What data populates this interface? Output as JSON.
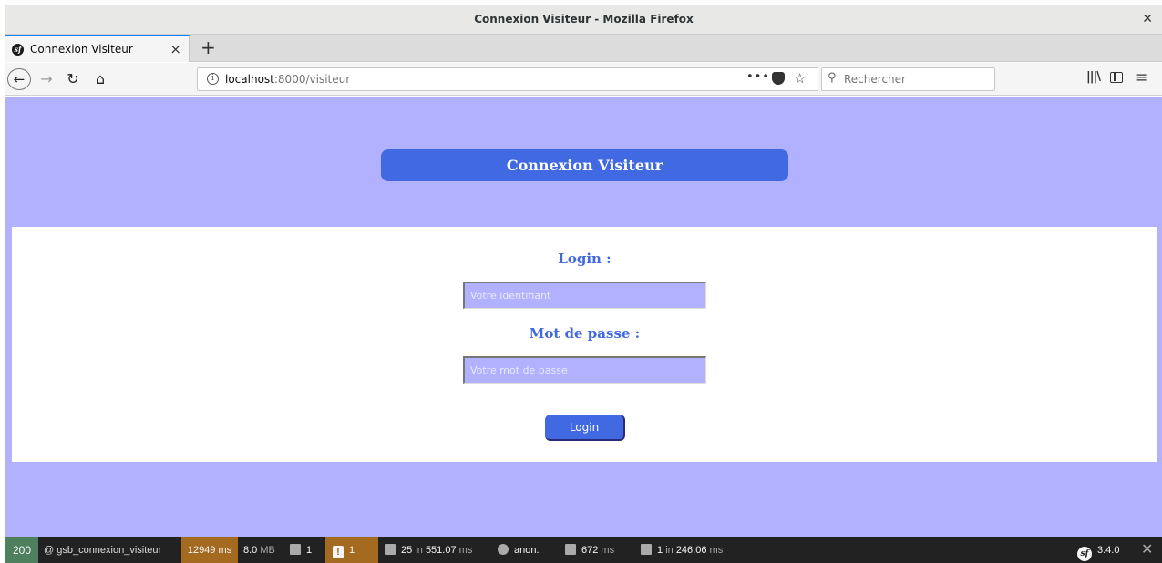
{
  "window": {
    "title": "Connexion Visiteur - Mozilla Firefox"
  },
  "tab": {
    "label": "Connexion Visiteur"
  },
  "navbar": {
    "url_host": "localhost",
    "url_path": ":8000/visiteur",
    "search_placeholder": "Rechercher"
  },
  "page": {
    "header": "Connexion Visiteur",
    "login_label": "Login :",
    "login_placeholder": "Votre identifiant",
    "password_label": "Mot de passe :",
    "password_placeholder": "Votre mot de passe",
    "submit_label": "Login"
  },
  "symfony_toolbar": {
    "status": "200",
    "route": "@ gsb_connexion_visiteur",
    "time_value": "12949",
    "time_unit": "ms",
    "memory_value": "8.0",
    "memory_unit": "MB",
    "forms_count": "1",
    "logs_count": "1",
    "doctrine_queries": "25",
    "doctrine_in": "in",
    "doctrine_time": "551.07",
    "doctrine_unit": "ms",
    "user": "anon.",
    "render_time": "672",
    "render_unit": "ms",
    "cache_count": "1",
    "cache_in": "in",
    "cache_time": "246.06",
    "cache_unit": "ms",
    "version": "3.4.0"
  },
  "colors": {
    "page_background": "#b1b1ff",
    "accent": "#4169e1",
    "status_ok": "#4f805d",
    "warning": "#a46a1f"
  }
}
